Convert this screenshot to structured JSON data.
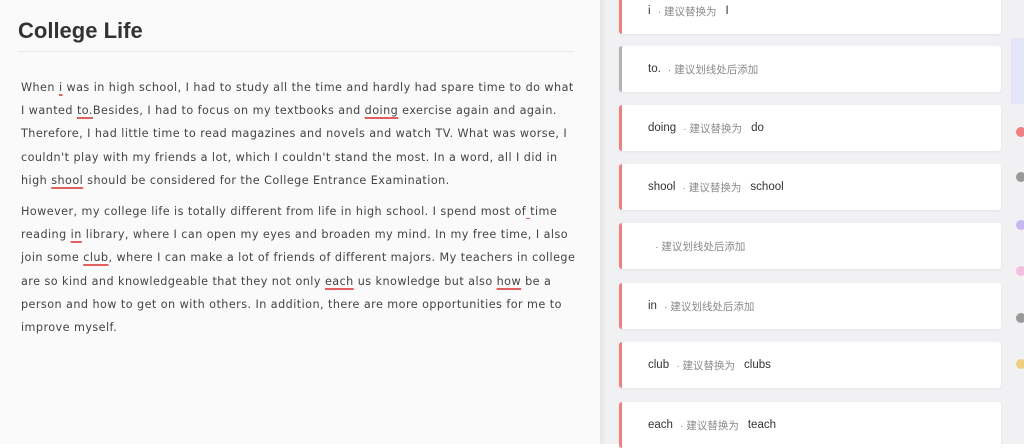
{
  "document": {
    "title": "College Life",
    "paragraphs": [
      [
        {
          "t": "When "
        },
        {
          "t": "i",
          "err": true
        },
        {
          "t": " was in high school, I had to study all the time and hardly had spare time to do what I wanted "
        },
        {
          "t": "to.",
          "err": true
        },
        {
          "t": "Besides, I had to focus on my textbooks and "
        },
        {
          "t": "doing",
          "err": true
        },
        {
          "t": " exercise again and again. Therefore, I had little time to read magazines and novels and watch TV. What was worse, I couldn't play with my friends a lot, which I couldn't stand the most. In a word, all I did in high "
        },
        {
          "t": "shool",
          "err": true
        },
        {
          "t": " should be considered for the College Entrance Examination."
        }
      ],
      [
        {
          "t": "However, my college life is totally different from life in high school. I spend most of"
        },
        {
          "t": " ",
          "gap": true
        },
        {
          "t": "time reading "
        },
        {
          "t": "in",
          "err": true
        },
        {
          "t": " library, where I can open my eyes and broaden my mind. In my free time, I also join some "
        },
        {
          "t": "club",
          "err": true
        },
        {
          "t": ", where I can make a lot of friends of different majors. My teachers in college are so kind and knowledgeable that they not only "
        },
        {
          "t": "each",
          "err": true
        },
        {
          "t": " us knowledge but also "
        },
        {
          "t": "how",
          "err": true
        },
        {
          "t": " be a person and how to get on with others. In addition, there are more opportunities for me to improve myself."
        }
      ]
    ]
  },
  "suggestions": [
    {
      "original": "i",
      "hint": "· 建议替换为",
      "replacement": "I",
      "kind": "replace"
    },
    {
      "original": "to.",
      "hint": "· 建议划线处后添加",
      "replacement": "",
      "kind": "insert"
    },
    {
      "original": "doing",
      "hint": "· 建议替换为",
      "replacement": "do",
      "kind": "replace"
    },
    {
      "original": "shool",
      "hint": "· 建议替换为",
      "replacement": "school",
      "kind": "replace"
    },
    {
      "original": "",
      "hint": "· 建议划线处后添加",
      "replacement": "",
      "kind": "insert"
    },
    {
      "original": "in",
      "hint": "· 建议划线处后添加",
      "replacement": "",
      "kind": "insert"
    },
    {
      "original": "club",
      "hint": "· 建议替换为",
      "replacement": "clubs",
      "kind": "replace"
    },
    {
      "original": "each",
      "hint": "· 建议替换为",
      "replacement": "teach",
      "kind": "replace"
    }
  ],
  "colors": {
    "error_underline": "#e06060",
    "card_accent_error": "#f07f7f",
    "card_accent_neutral": "#b3b3b3",
    "edge_dots": [
      "#f08080",
      "#9a9a9a",
      "#c9b8f0",
      "#f3c0e0",
      "#9a9a9a",
      "#f0d080"
    ]
  }
}
